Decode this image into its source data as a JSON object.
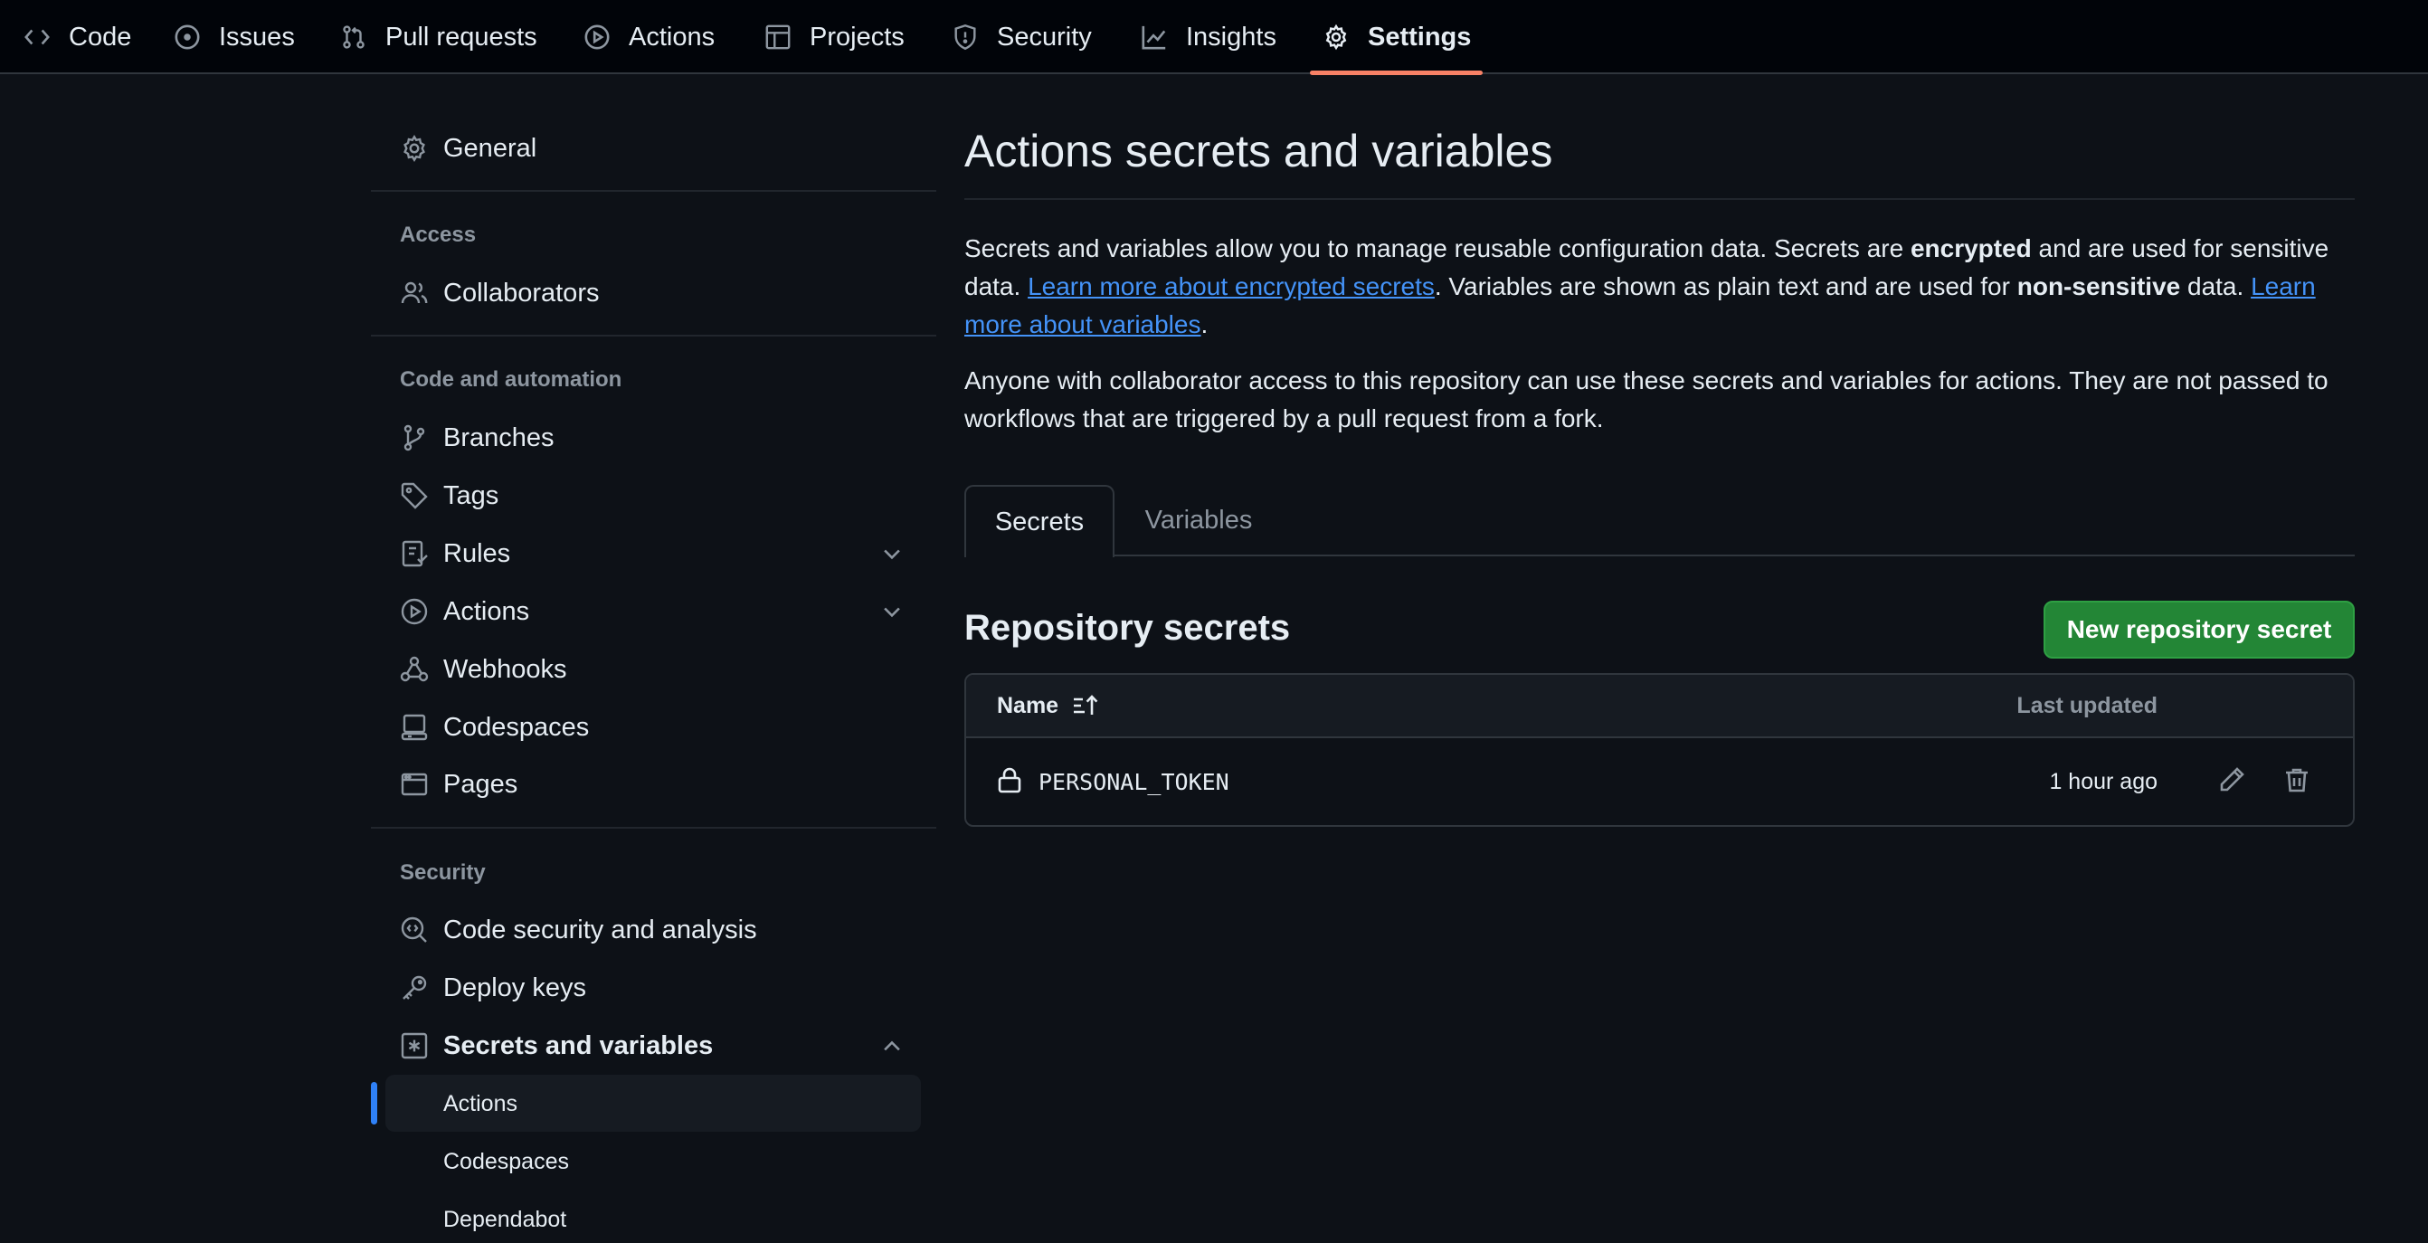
{
  "topnav": {
    "tabs": [
      {
        "label": "Code",
        "icon": "code-icon"
      },
      {
        "label": "Issues",
        "icon": "issue-icon"
      },
      {
        "label": "Pull requests",
        "icon": "pull-request-icon"
      },
      {
        "label": "Actions",
        "icon": "play-icon"
      },
      {
        "label": "Projects",
        "icon": "table-icon"
      },
      {
        "label": "Security",
        "icon": "shield-icon"
      },
      {
        "label": "Insights",
        "icon": "graph-icon"
      },
      {
        "label": "Settings",
        "icon": "gear-icon",
        "active": true
      }
    ]
  },
  "sidebar": {
    "general": "General",
    "access_heading": "Access",
    "collaborators": "Collaborators",
    "code_heading": "Code and automation",
    "branches": "Branches",
    "tags": "Tags",
    "rules": "Rules",
    "actions": "Actions",
    "webhooks": "Webhooks",
    "codespaces": "Codespaces",
    "pages": "Pages",
    "security_heading": "Security",
    "code_security": "Code security and analysis",
    "deploy_keys": "Deploy keys",
    "secrets_variables": "Secrets and variables",
    "sub_items": [
      "Actions",
      "Codespaces",
      "Dependabot"
    ]
  },
  "main": {
    "title": "Actions secrets and variables",
    "para1": {
      "t1": "Secrets and variables allow you to manage reusable configuration data. Secrets are ",
      "b1": "encrypted",
      "t2": " and are used for sensitive data. ",
      "link1": "Learn more about encrypted secrets",
      "t3": ". Variables are shown as plain text and are used for ",
      "b2": "non-sensitive",
      "t4": " data. ",
      "link2": "Learn more about variables",
      "t5": "."
    },
    "para2": "Anyone with collaborator access to this repository can use these secrets and variables for actions. They are not passed to workflows that are triggered by a pull request from a fork.",
    "tabs": [
      "Secrets",
      "Variables"
    ],
    "section_title": "Repository secrets",
    "new_button": "New repository secret",
    "table": {
      "col_name": "Name",
      "col_updated": "Last updated",
      "rows": [
        {
          "name": "PERSONAL_TOKEN",
          "updated": "1 hour ago"
        }
      ]
    }
  },
  "colors": {
    "background": "#0d1117",
    "accent_underline": "#f78166",
    "link": "#4493f8",
    "primary_button": "#238636",
    "active_indicator": "#2f81f7"
  }
}
